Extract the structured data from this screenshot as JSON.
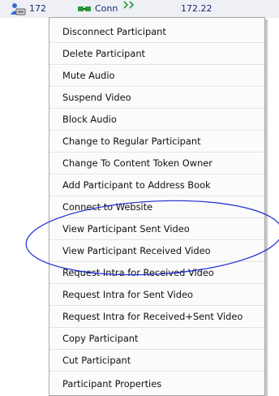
{
  "behind_row": {
    "cells": [
      "172",
      "Conn",
      "172.22"
    ],
    "icons": [
      "participant-icon",
      "connection-icon",
      "status-icon"
    ]
  },
  "menu": {
    "items": [
      "Disconnect Participant",
      "Delete Participant",
      "Mute Audio",
      "Suspend Video",
      "Block Audio",
      "Change to Regular Participant",
      "Change To Content Token Owner",
      "Add Participant to Address Book",
      "Connect to Website",
      "View Participant Sent Video",
      "View Participant Received Video",
      "Request Intra for Received Video",
      "Request Intra for Sent Video",
      "Request Intra for Received+Sent Video",
      "Copy Participant",
      "Cut Participant",
      "Participant Properties"
    ]
  },
  "annotation": {
    "color": "#1c2bd1"
  }
}
